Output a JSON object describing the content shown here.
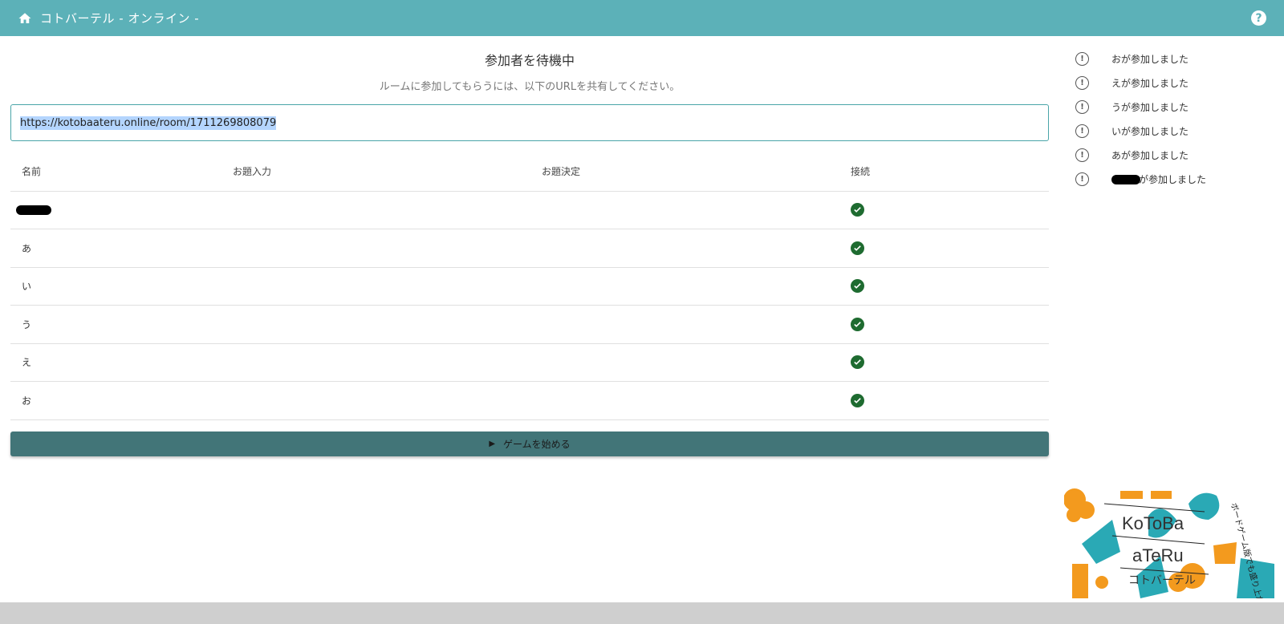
{
  "appbar": {
    "title": "コトバーテル - オンライン -",
    "home_icon": "home-icon",
    "help_icon": "help-icon",
    "help_label": "?"
  },
  "main": {
    "heading": "参加者を待機中",
    "subtext": "ルームに参加してもらうには、以下のURLを共有してください。",
    "room_url": "https://kotobaateru.online/room/1711269808079",
    "table": {
      "headers": [
        "名前",
        "お題入力",
        "お題決定",
        "接続"
      ],
      "rows": [
        {
          "name": "",
          "redacted": true,
          "connected": true
        },
        {
          "name": "あ",
          "connected": true
        },
        {
          "name": "い",
          "connected": true
        },
        {
          "name": "う",
          "connected": true
        },
        {
          "name": "え",
          "connected": true
        },
        {
          "name": "お",
          "connected": true
        }
      ]
    },
    "start_button": "ゲームを始める"
  },
  "notifications": [
    {
      "text": "おが参加しました"
    },
    {
      "text": "えが参加しました"
    },
    {
      "text": "うが参加しました"
    },
    {
      "text": "いが参加しました"
    },
    {
      "text": "あが参加しました"
    },
    {
      "text": "が参加しました",
      "redacted": true
    }
  ],
  "logo": {
    "line1": "KoToBa",
    "line2": "aTeRu",
    "line3": "コトバーテル",
    "tagline": "ボードゲーム版でも盛り上がろう!"
  },
  "colors": {
    "appbar": "#5cb1b8",
    "button": "#427578",
    "check": "#1e6b30",
    "accent_orange": "#f39a1e",
    "accent_teal": "#2aa9b5"
  }
}
